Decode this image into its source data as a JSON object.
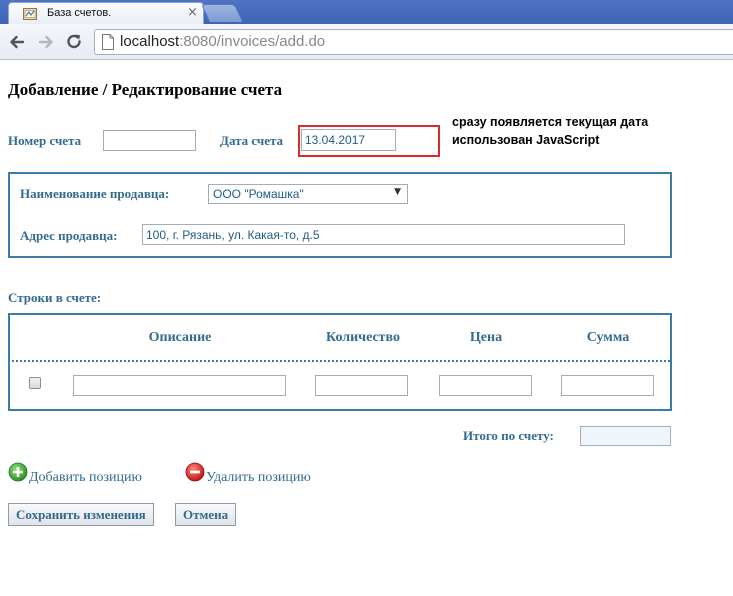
{
  "browser": {
    "tab_title": "База счетов.",
    "tab_close": "×",
    "url_host": "localhost",
    "url_path": ":8080/invoices/add.do"
  },
  "page": {
    "title": "Добавление / Редактирование счета"
  },
  "header_fields": {
    "invoice_number_label": "Номер счета",
    "invoice_number_value": "",
    "invoice_date_label": "Дата счета",
    "invoice_date_value": "13.04.2017"
  },
  "annotation": {
    "line1": "сразу появляется текущая дата",
    "line2": "использован JavaScript",
    "border_color": "#d92b2b"
  },
  "seller": {
    "name_label": "Наименование продавца:",
    "name_selected": "ООО \"Ромашка\"",
    "address_label": "Адрес продавца:",
    "address_value": "100, г. Рязань, ул. Какая-то, д.5"
  },
  "lines": {
    "section_label": "Строки в счете:",
    "columns": [
      "Описание",
      "Количество",
      "Цена",
      "Сумма"
    ],
    "rows": [
      {
        "checked": false,
        "description": "",
        "quantity": "",
        "price": "",
        "sum": ""
      }
    ]
  },
  "total": {
    "label": "Итого по счету:",
    "value": ""
  },
  "actions": {
    "add_label": "Добавить позицию",
    "remove_label": "Удалить позицию",
    "save_label": "Сохранить изменения",
    "cancel_label": "Отмена"
  },
  "colors": {
    "accent": "#336b8f",
    "border": "#3a7ca5",
    "add_icon": "#3aa537",
    "remove_icon": "#d32222"
  },
  "icons": [
    "folder-favicon",
    "back-arrow-icon",
    "forward-arrow-icon",
    "reload-icon",
    "page-icon",
    "plus-circle-icon",
    "minus-circle-icon"
  ]
}
